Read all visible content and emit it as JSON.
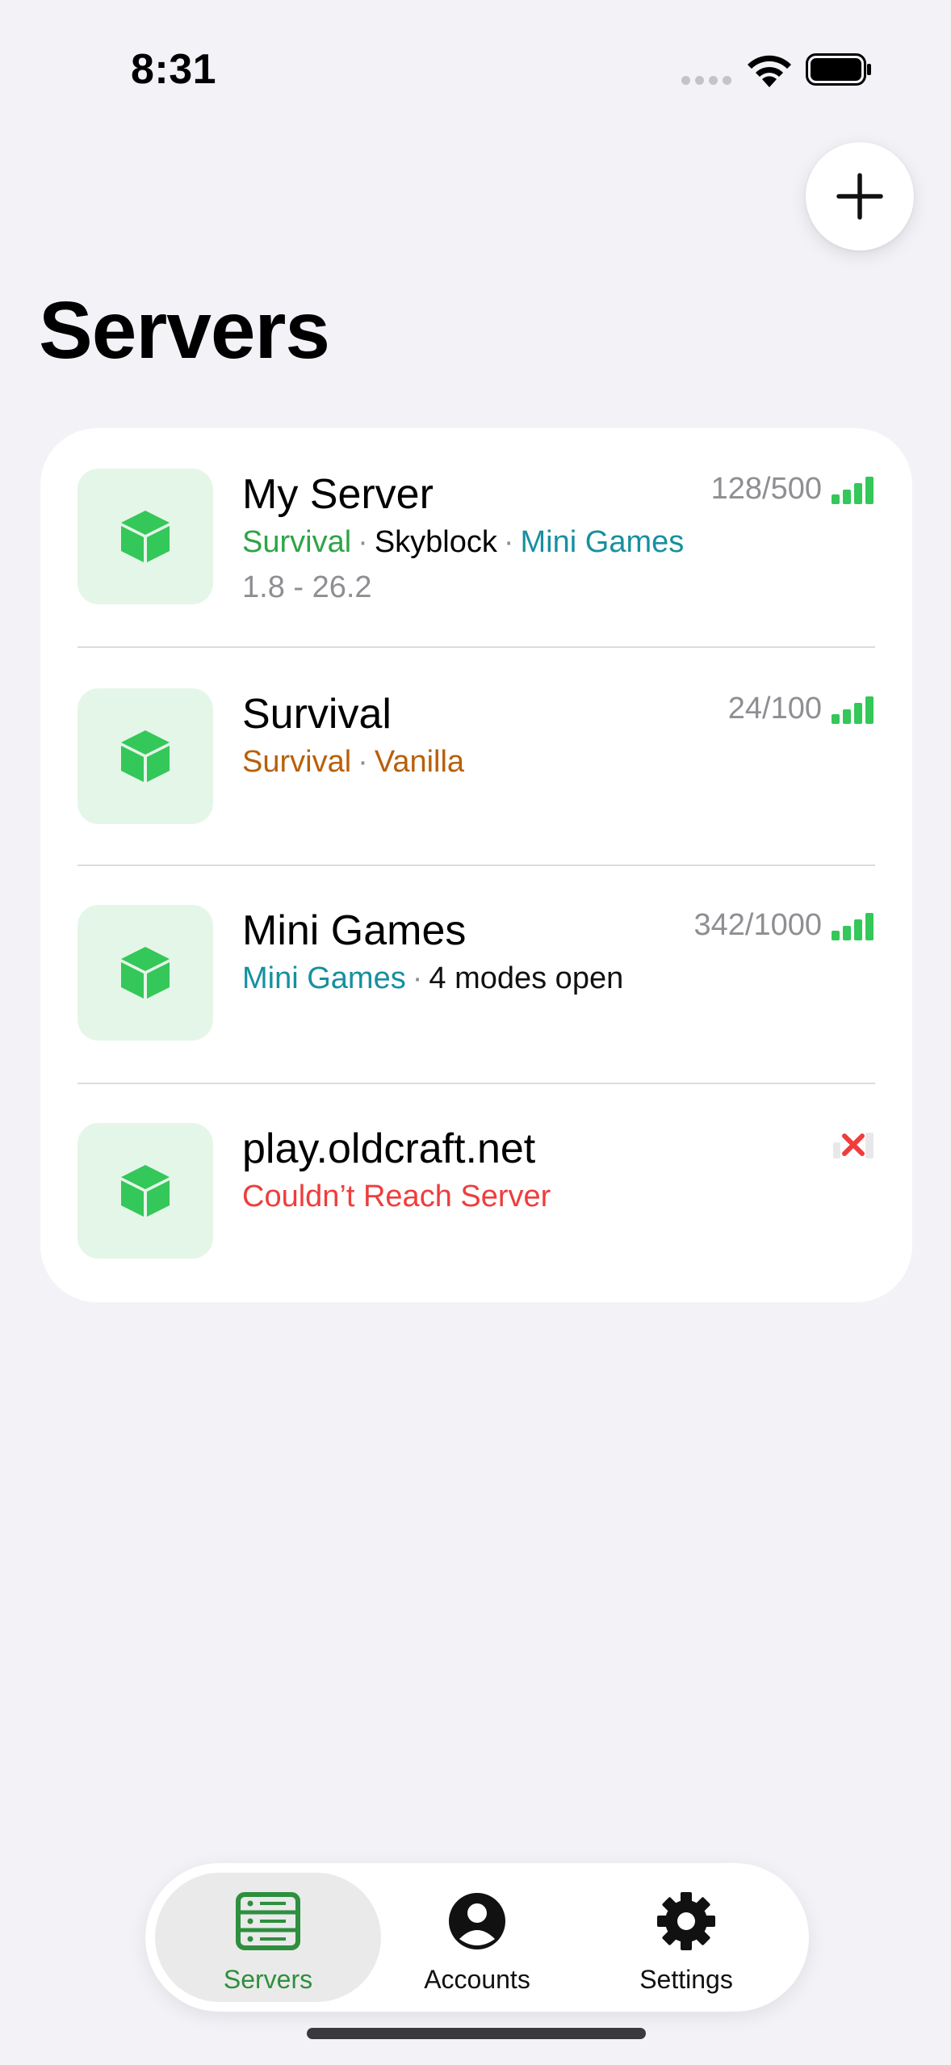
{
  "status_bar": {
    "time": "8:31"
  },
  "header": {
    "title": "Servers",
    "add_icon": "plus-icon"
  },
  "servers": [
    {
      "name": "My Server",
      "players": "128/500",
      "tags": [
        "Survival",
        "Skyblock",
        "Mini Games"
      ],
      "version": "1.8 - 26.2",
      "status": "online"
    },
    {
      "name": "Survival",
      "players": "24/100",
      "tags": [
        "Survival",
        "Vanilla"
      ],
      "status": "online"
    },
    {
      "name": "Mini Games",
      "players": "342/1000",
      "tags": [
        "Mini Games",
        "4 modes open"
      ],
      "status": "online"
    },
    {
      "name": "play.oldcraft.net",
      "error": "Couldn’t Reach Server",
      "status": "offline"
    }
  ],
  "tabs": [
    {
      "label": "Servers",
      "icon": "server-icon",
      "active": true
    },
    {
      "label": "Accounts",
      "icon": "person-circle-icon",
      "active": false
    },
    {
      "label": "Settings",
      "icon": "gear-icon",
      "active": false
    }
  ],
  "colors": {
    "accent_green": "#34c759",
    "tag_green": "#2ea446",
    "tag_teal": "#16909f",
    "tag_orange": "#b8600a",
    "error_red": "#ef3d3d"
  }
}
